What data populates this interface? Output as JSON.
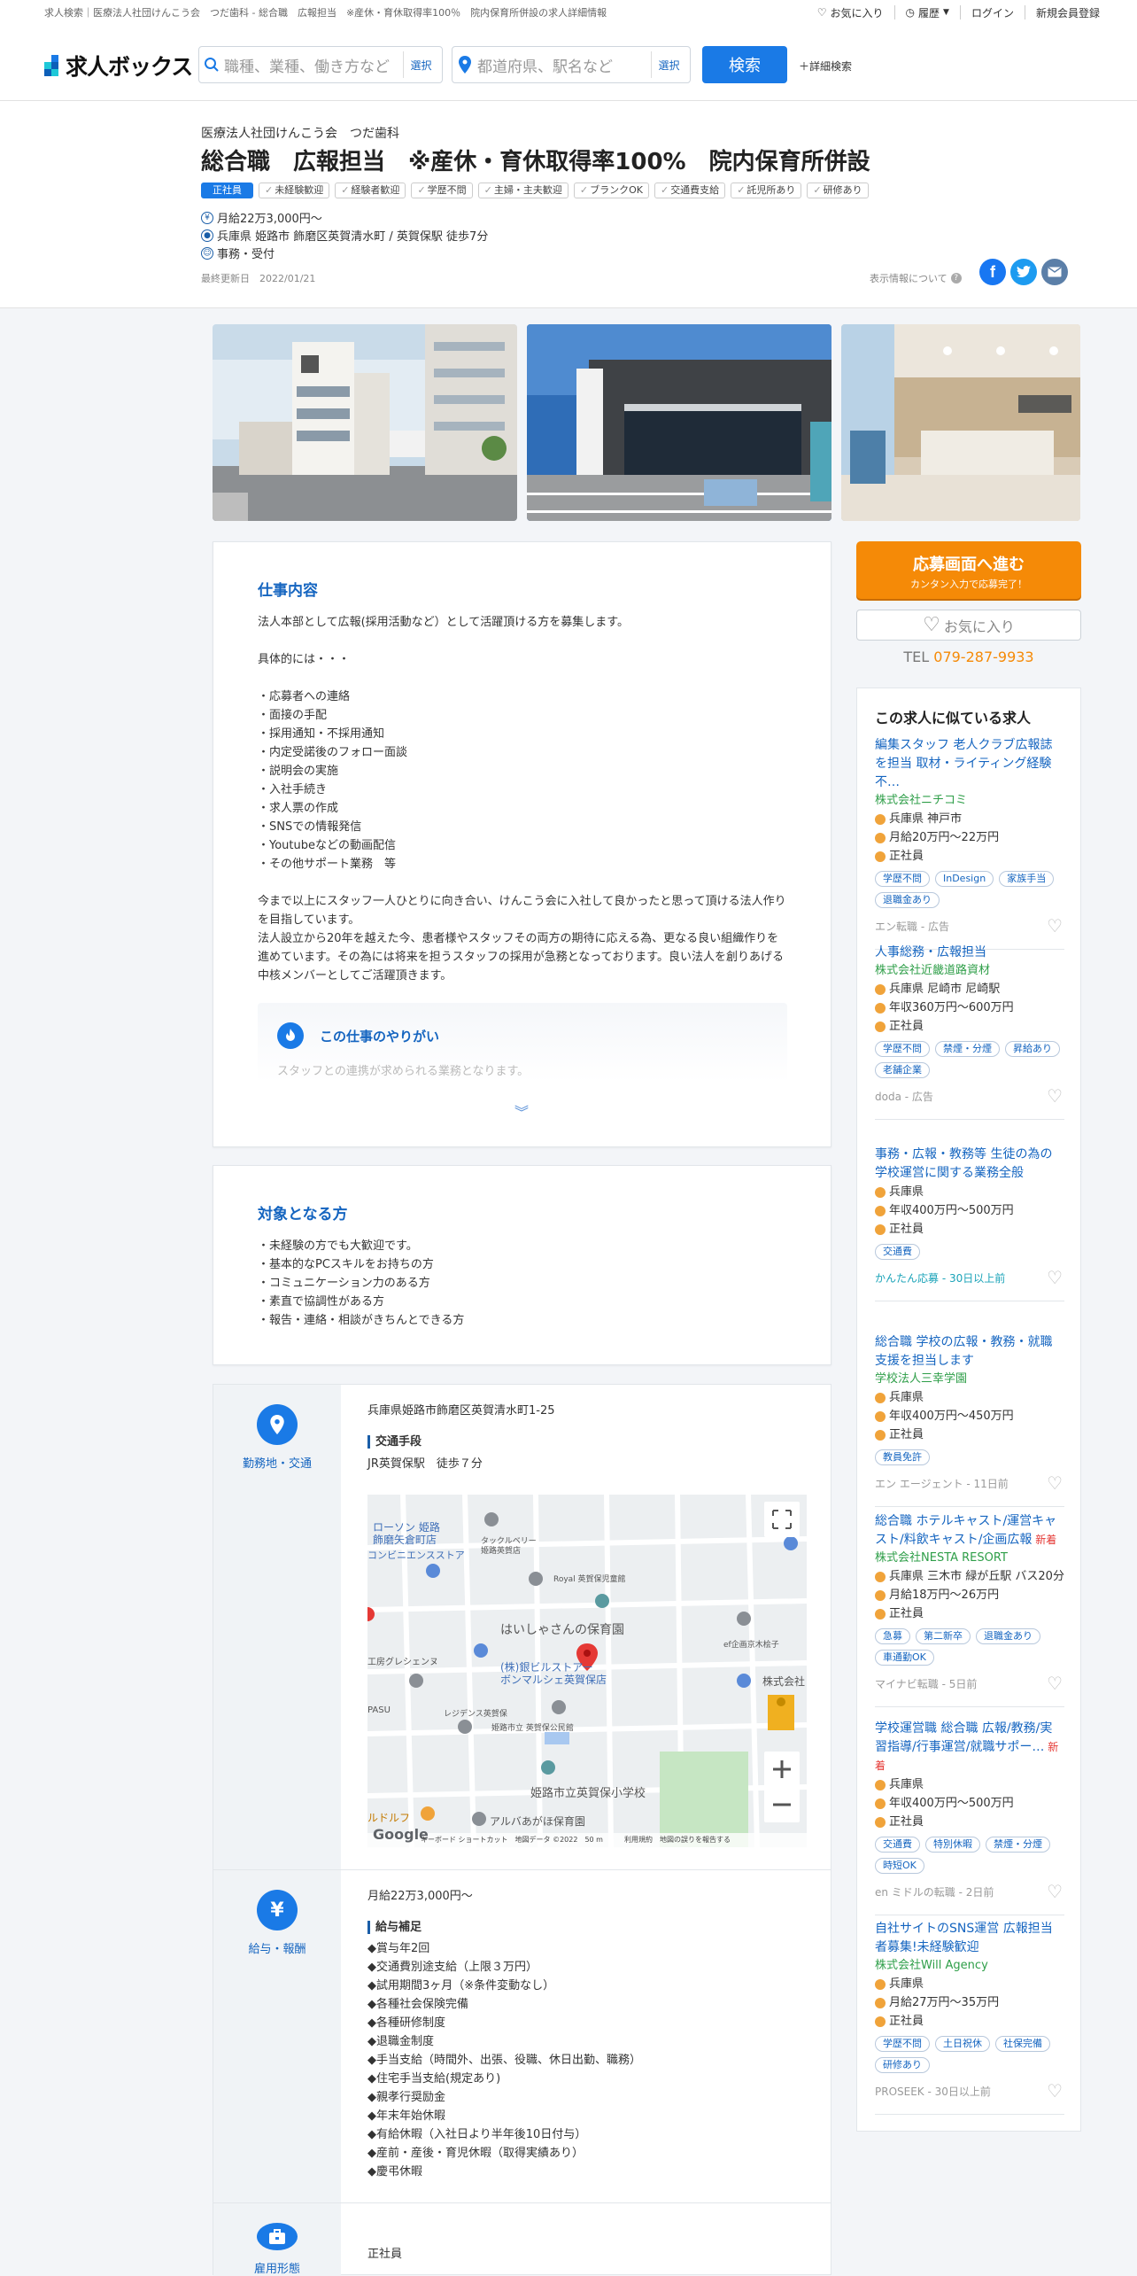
{
  "breadcrumb": "求人検索｜医療法人社団けんこう会　つだ歯科 - 総合職　広報担当　※産休・育休取得率100％　院内保育所併設の求人詳細情報",
  "header": {
    "favorite": "お気に入り",
    "history": "履歴",
    "login": "ログイン",
    "register": "新規会員登録",
    "logo": "求人ボックス",
    "keyword_placeholder": "職種、業種、働き方など",
    "area_placeholder": "都道府県、駅名など",
    "select_label": "選択",
    "search_button": "検索",
    "detail_search": "詳細検索"
  },
  "job": {
    "company": "医療法人社団けんこう会　つだ歯科",
    "title": "総合職　広報担当　※産休・育休取得率100%　院内保育所併設",
    "employment_tag": "正社員",
    "tags": [
      "未経験歓迎",
      "経験者歓迎",
      "学歴不問",
      "主婦・主夫歓迎",
      "ブランクOK",
      "交通費支給",
      "託児所あり",
      "研修あり"
    ],
    "salary": "月給22万3,000円～",
    "location": "兵庫県 姫路市 飾磨区英賀清水町 / 英賀保駅 徒歩7分",
    "category": "事務・受付",
    "updated": "最終更新日　2022/01/21",
    "about_info": "表示情報について"
  },
  "work": {
    "heading": "仕事内容",
    "body": "法人本部として広報(採用活動など）として活躍頂ける方を募集します。\n\n具体的には・・・\n\n・応募者への連絡\n・面接の手配\n・採用通知・不採用通知\n・内定受諾後のフォロー面談\n・説明会の実施\n・入社手続き\n・求人票の作成\n・SNSでの情報発信\n・Youtubeなどの動画配信\n・その他サポート業務　等\n\n今まで以上にスタッフ一人ひとりに向き合い、けんこう会に入社して良かったと思って頂ける法人作りを目指しています。\n法人設立から20年を越えた今、患者様やスタッフその両方の期待に応える為、更なる良い組織作りを進めています。その為には将来を担うスタッフの採用が急務となっております。良い法人を創りあげる中核メンバーとしてご活躍頂きます。",
    "yarigai_heading": "この仕事のやりがい",
    "yarigai_preview": "スタッフとの連携が求められる業務となります。"
  },
  "target": {
    "heading": "対象となる方",
    "body": "・未経験の方でも大歓迎です。\n・基本的なPCスキルをお持ちの方\n・コミュニケーション力のある方\n・素直で協調性がある方\n・報告・連絡・相談がきちんとできる方"
  },
  "access": {
    "label": "勤務地・交通",
    "address": "兵庫県姫路市飾磨区英賀清水町1-25",
    "transport_heading": "交通手段",
    "transport": "JR英賀保駅　徒歩７分",
    "map_labels": {
      "lawson": "ローソン 姫路\n飾磨矢倉町店",
      "conv": "コンビニエンスストア",
      "bakery": "タックルベリー\n姫路英賀店",
      "royal": "Royal 英賀保児童館",
      "nursery": "はいしゃさんの保育園",
      "chrysanthemum": "(株)銀ビルストアー\nボンマルシェ英賀保店",
      "residence": "レジデンス英賀保",
      "park": "姫路市立 英賀保公民館",
      "school": "姫路市立英賀保小学校",
      "alba": "アルバあがほ保育園",
      "stone": "ef企画京木桧子",
      "kk": "株式会社",
      "kobo": "工房グレシェンヌ",
      "dolphin": "ルドルフ",
      "pasu": "PASU",
      "footer": "キーボード ショートカット　地図データ ©2022　50 m　　　利用規約　地図の誤りを報告する",
      "google": "Google"
    }
  },
  "salary_section": {
    "label": "給与・報酬",
    "salary": "月給22万3,000円～",
    "supplement_heading": "給与補足",
    "body": "◆賞与年2回\n◆交通費別途支給（上限３万円）\n◆試用期間3ヶ月（※条件変動なし）\n◆各種社会保険完備\n◆各種研修制度\n◆退職金制度\n◆手当支給（時間外、出張、役職、休日出勤、職務）\n◆住宅手当支給(規定あり)\n◆親孝行奨励金\n◆年末年始休暇\n◆有給休暇（入社日より半年後10日付与）\n◆産前・産後・育児休暇（取得実績あり）\n◆慶弔休暇"
  },
  "employment_section": {
    "label": "雇用形態",
    "value": "正社員"
  },
  "sidebar": {
    "apply_main": "応募画面へ進む",
    "apply_sub": "カンタン入力で応募完了！",
    "favorite": "お気に入り",
    "tel_label": "TEL",
    "tel_number": "079-287-9933",
    "similar_heading": "この求人に似ている求人",
    "jobs": [
      {
        "title": "編集スタッフ 老人クラブ広報誌を担当 取材・ライティング経験不…",
        "new": "",
        "company": "株式会社ニチコミ",
        "location": "兵庫県 神戸市",
        "salary": "月給20万円～22万円",
        "type": "正社員",
        "pills": [
          "学歴不問",
          "InDesign",
          "家族手当",
          "退職金あり"
        ],
        "source": "エン転職 - 広告"
      },
      {
        "title": "人事総務・広報担当",
        "new": "",
        "company": "株式会社近畿道路資材",
        "location": "兵庫県 尼崎市 尼崎駅",
        "salary": "年収360万円～600万円",
        "type": "正社員",
        "pills": [
          "学歴不問",
          "禁煙・分煙",
          "昇給あり",
          "老舗企業"
        ],
        "source": "doda - 広告"
      },
      {
        "title": "事務・広報・教務等 生徒の為の学校運営に関する業務全般",
        "new": "",
        "company": "",
        "location": "兵庫県",
        "salary": "年収400万円～500万円",
        "type": "正社員",
        "pills": [
          "交通費"
        ],
        "source": "かんたん応募 - 30日以上前"
      },
      {
        "title": "総合職 学校の広報・教務・就職支援を担当します",
        "new": "",
        "company": "学校法人三幸学園",
        "location": "兵庫県",
        "salary": "年収400万円～450万円",
        "type": "正社員",
        "pills": [
          "教員免許"
        ],
        "source": "エン エージェント - 11日前"
      },
      {
        "title": "総合職 ホテルキャスト/運営キャスト/料飲キャスト/企画広報",
        "new": "新着",
        "company": "株式会社NESTA RESORT",
        "location": "兵庫県 三木市 緑が丘駅 バス20分",
        "salary": "月給18万円～26万円",
        "type": "正社員",
        "pills": [
          "急募",
          "第二新卒",
          "退職金あり",
          "車通勤OK"
        ],
        "source": "マイナビ転職 - 5日前"
      },
      {
        "title": "学校運営職 総合職 広報/教務/実習指導/行事運営/就職サポー…",
        "new": "新着",
        "company": "",
        "location": "兵庫県",
        "salary": "年収400万円～500万円",
        "type": "正社員",
        "pills": [
          "交通費",
          "特別休暇",
          "禁煙・分煙",
          "時短OK"
        ],
        "source": "en ミドルの転職 - 2日前"
      },
      {
        "title": "自社サイトのSNS運営 広報担当者募集!未経験歓迎",
        "new": "",
        "company": "株式会社Will Agency",
        "location": "兵庫県",
        "salary": "月給27万円～35万円",
        "type": "正社員",
        "pills": [
          "学歴不問",
          "土日祝休",
          "社保完備",
          "研修あり"
        ],
        "source": "PROSEEK - 30日以上前"
      }
    ]
  },
  "colors": {
    "accent": "#1a7ae6",
    "orange": "#f58a07",
    "green": "#2e9e48",
    "link": "#1565c0"
  }
}
